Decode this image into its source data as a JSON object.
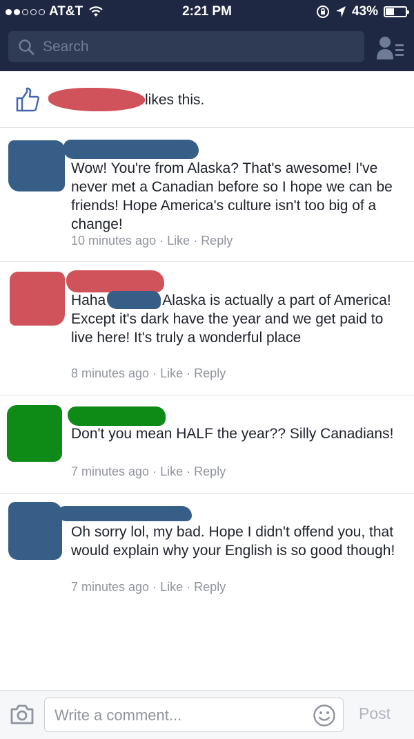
{
  "status_bar": {
    "carrier": "AT&T",
    "time": "2:21 PM",
    "battery": "43%",
    "battery_level": 0.43,
    "signal_bars_filled": 2,
    "signal_bars_total": 5
  },
  "search": {
    "placeholder": "Search"
  },
  "likes": {
    "text": "likes this."
  },
  "comments": [
    {
      "text": "Wow! You're from Alaska? That's awesome! I've never met a Canadian before so I hope we can be friends! Hope America's culture isn't too big of a change!",
      "time": "10 minutes ago",
      "like_label": "Like",
      "reply_label": "Reply",
      "redaction_color": "#365e86"
    },
    {
      "text_before": "Haha",
      "text_after": "Alaska is actually a part of America! Except it's dark have the year and we get paid to live here! It's truly a wonderful place",
      "time": "8 minutes ago",
      "like_label": "Like",
      "reply_label": "Reply",
      "redaction_color": "#d0535c"
    },
    {
      "text": "Don't you mean HALF the year?? Silly Canadians!",
      "time": "7 minutes ago",
      "like_label": "Like",
      "reply_label": "Reply",
      "redaction_color": "#0e8a17"
    },
    {
      "text": "Oh sorry lol, my bad. Hope I didn't offend you, that would explain why your English is so good though!",
      "time": "7 minutes ago",
      "like_label": "Like",
      "reply_label": "Reply",
      "redaction_color": "#365e86"
    }
  ],
  "footer": {
    "placeholder": "Write a comment...",
    "post_label": "Post"
  },
  "meta_separator": "·",
  "colors": {
    "header_bg": "#1e2842",
    "link_blue": "#4267b2",
    "meta_gray": "#90949c"
  }
}
